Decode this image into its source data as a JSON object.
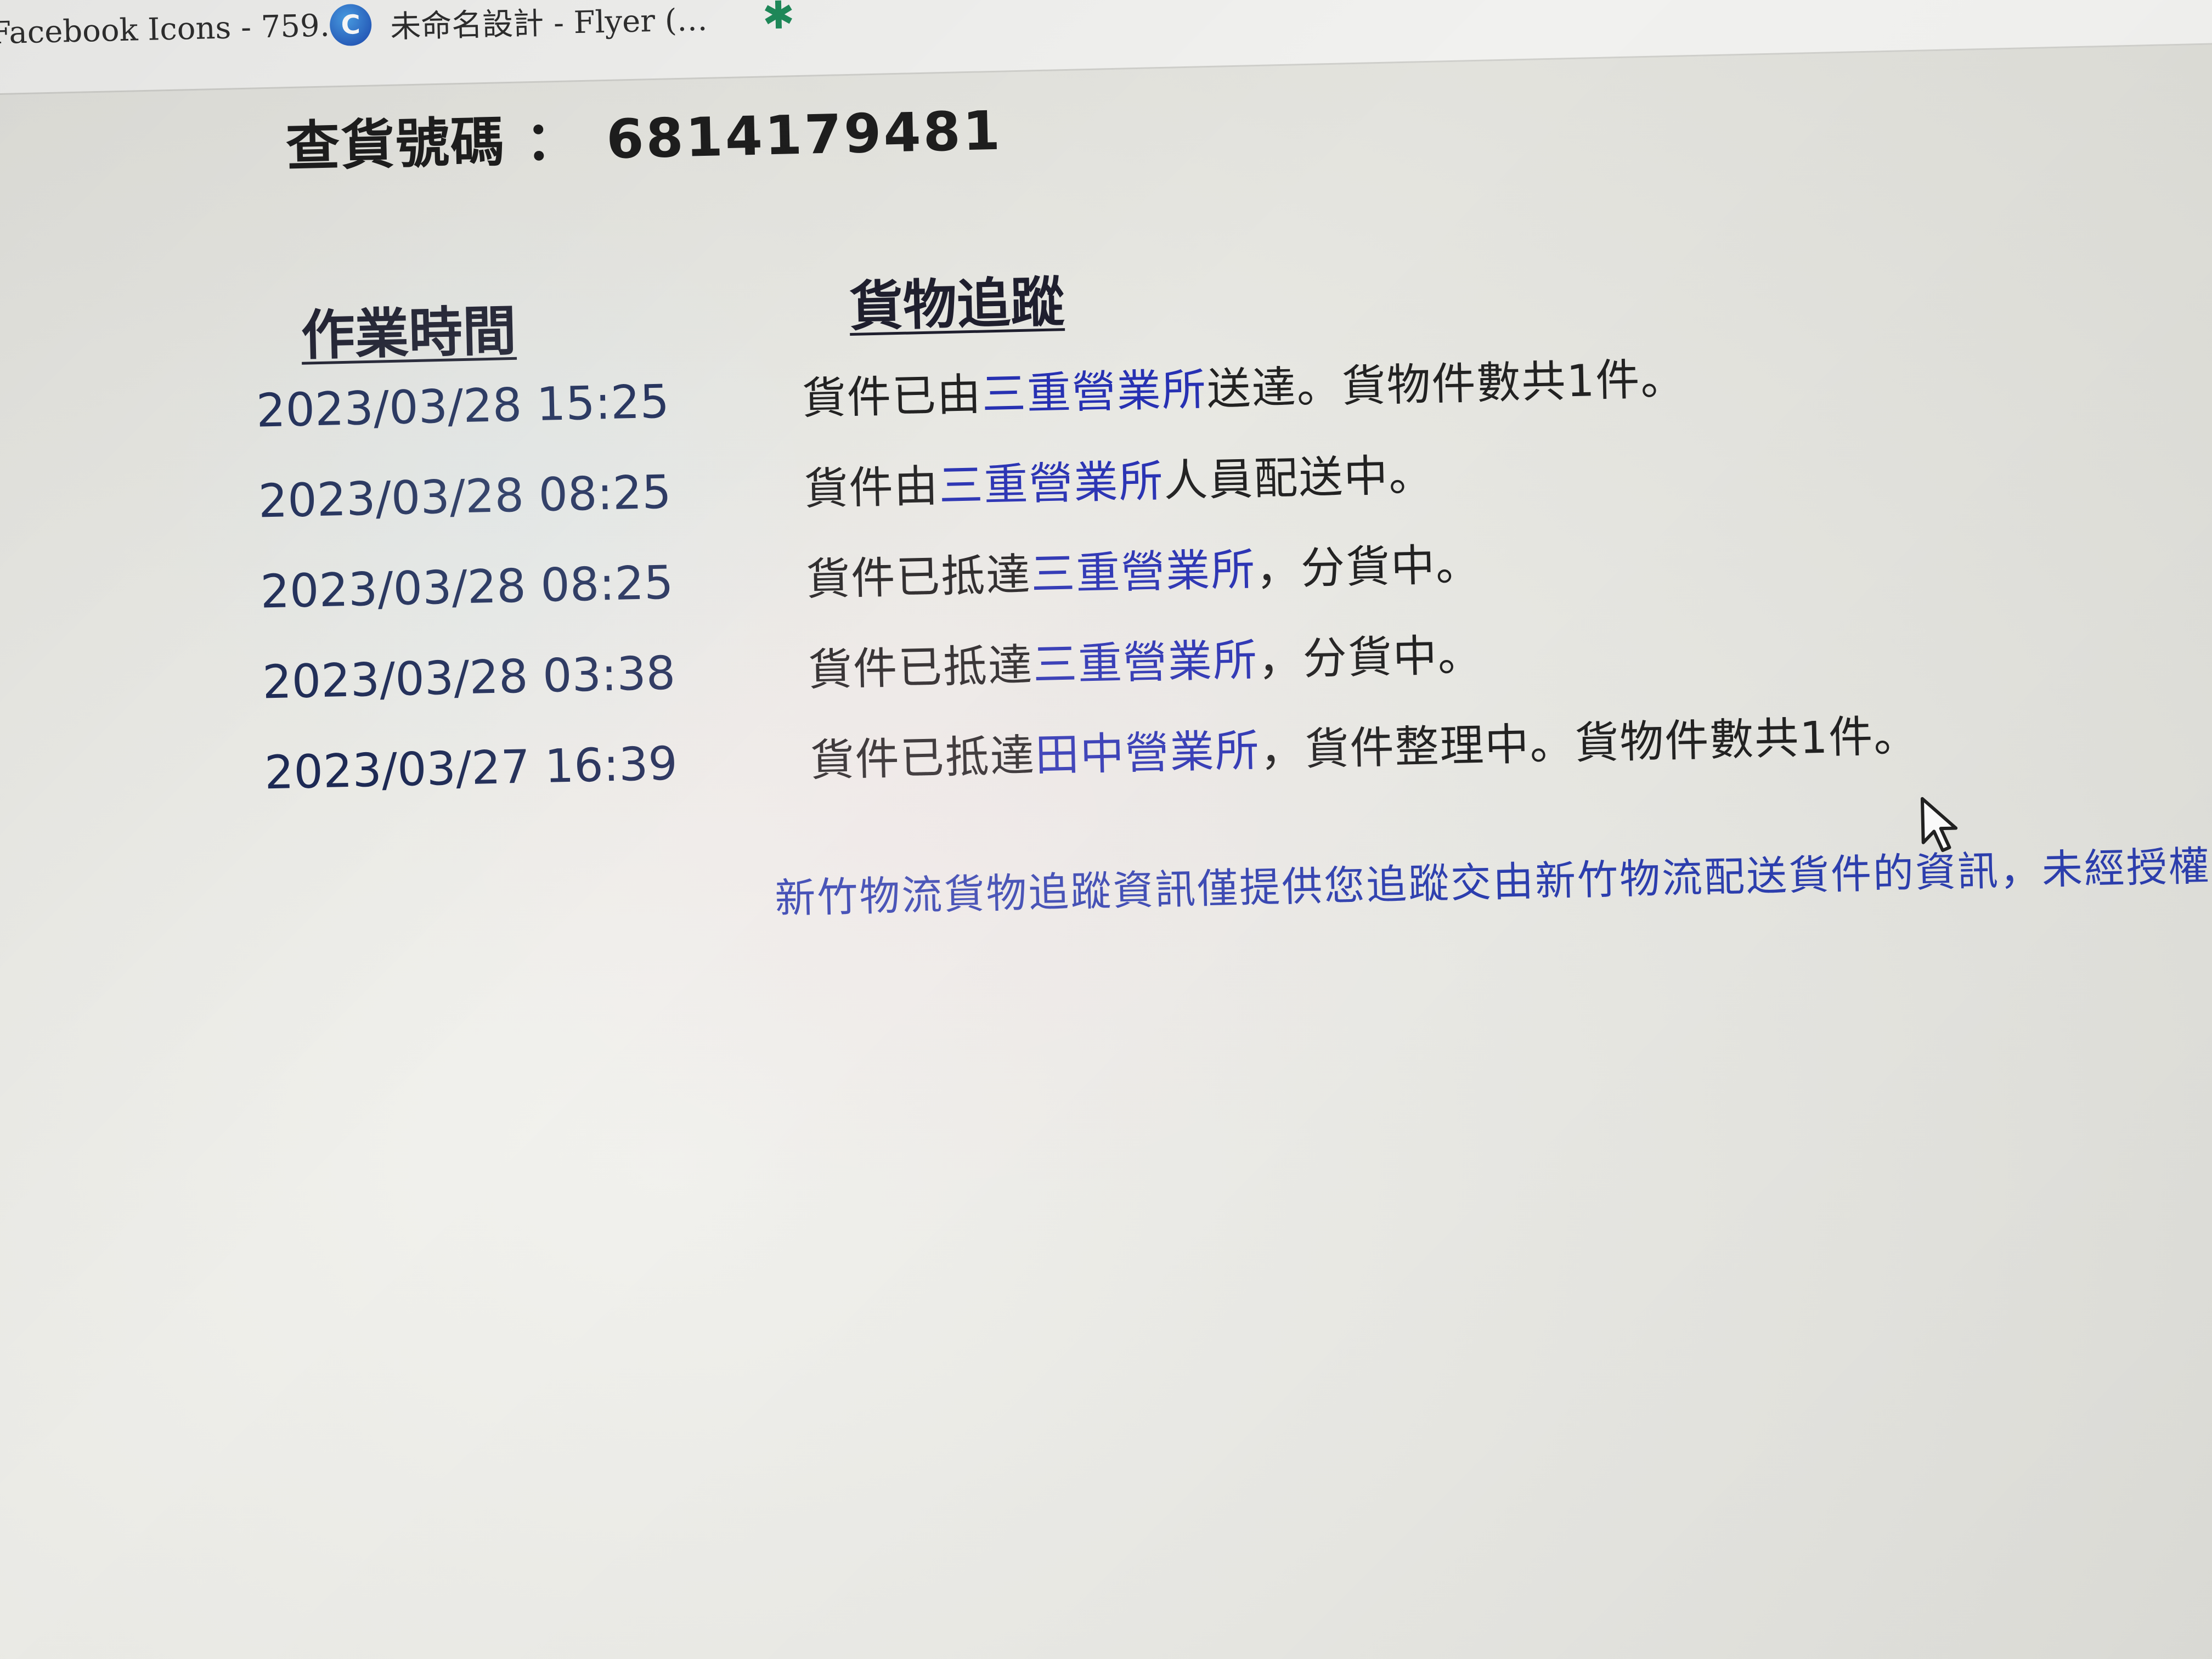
{
  "browser": {
    "tabs": [
      {
        "label": "Facebook Icons - 759…",
        "icon": "none"
      },
      {
        "label": "未命名設計 - Flyer (…",
        "icon": "c-circle-icon"
      },
      {
        "label": "",
        "icon": "leaf-icon"
      }
    ]
  },
  "page": {
    "tracking_label": "查貨號碼 ：",
    "tracking_number": "6814179481",
    "headers": {
      "time": "作業時間",
      "tracking": "貨物追蹤"
    },
    "rows": [
      {
        "time": "2023/03/28 15:25",
        "status_prefix": "貨件已由",
        "office": "三重營業所",
        "status_suffix": "送達。貨物件數共1件。"
      },
      {
        "time": "2023/03/28 08:25",
        "status_prefix": "貨件由",
        "office": "三重營業所",
        "status_suffix": "人員配送中。"
      },
      {
        "time": "2023/03/28 08:25",
        "status_prefix": "貨件已抵達",
        "office": "三重營業所",
        "status_suffix": "，分貨中。"
      },
      {
        "time": "2023/03/28 03:38",
        "status_prefix": "貨件已抵達",
        "office": "三重營業所",
        "status_suffix": "，分貨中。"
      },
      {
        "time": "2023/03/27 16:39",
        "status_prefix": "貨件已抵達",
        "office": "田中營業所",
        "status_suffix": "，貨件整理中。貨物件數共1件。"
      }
    ],
    "notice": "新竹物流貨物追蹤資訊僅提供您追蹤交由新竹物流配送貨件的資訊，未經授權"
  },
  "colors": {
    "link": "#2731b3",
    "time_text": "#1d2a55",
    "notice": "#2d3fb0"
  }
}
